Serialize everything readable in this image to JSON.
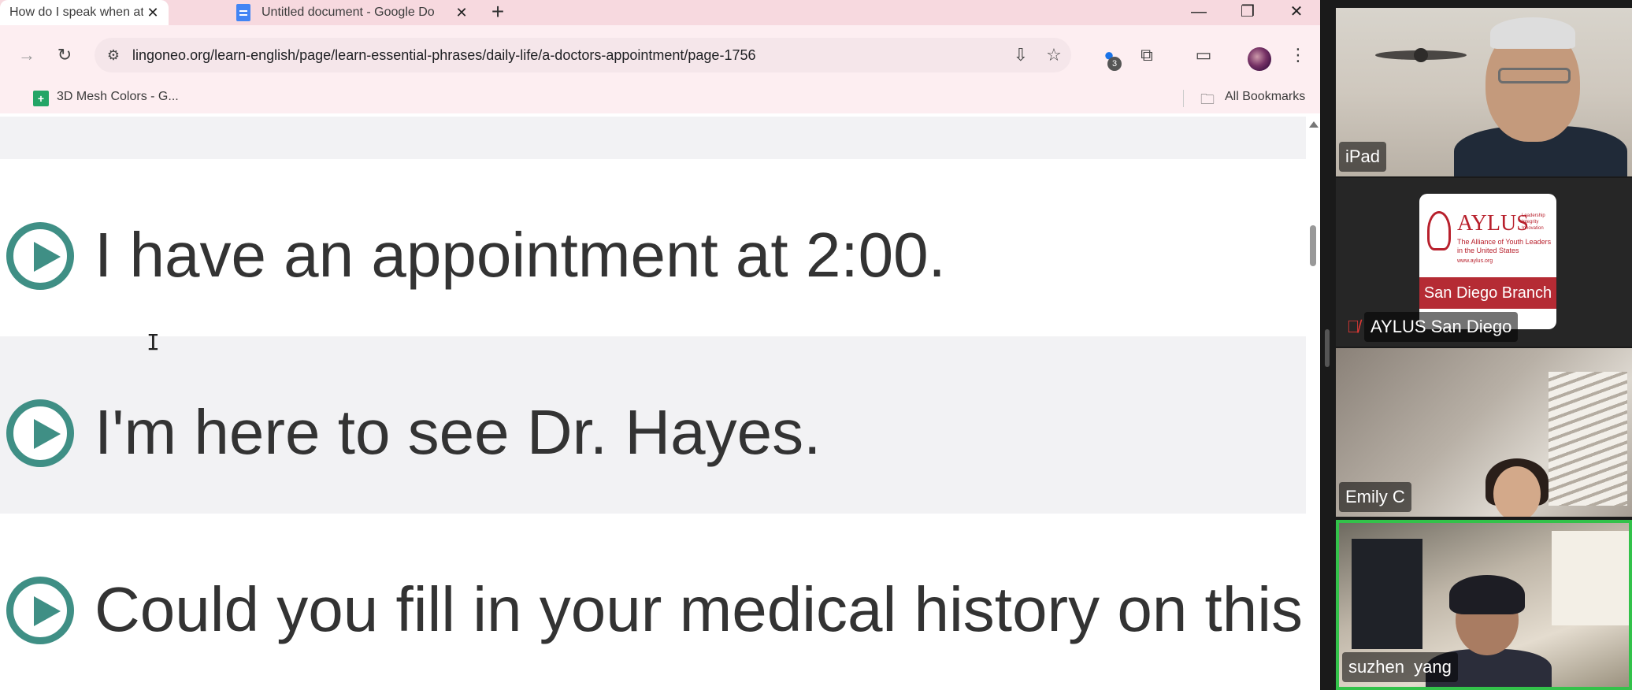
{
  "browser": {
    "tabs": [
      {
        "title": "How do I speak when at the do",
        "active": true
      },
      {
        "title": "Untitled document - Google Do",
        "active": false
      }
    ],
    "new_tab_label": "+",
    "window_controls": {
      "minimize": "—",
      "restore": "❐",
      "close": "✕"
    },
    "url": "lingoneo.org/learn-english/page/learn-essential-phrases/daily-life/a-doctors-appointment/page-1756",
    "extension_badge": "3",
    "bookmarks": {
      "item_label": "3D Mesh Colors - G...",
      "all_bookmarks": "All Bookmarks"
    }
  },
  "page": {
    "phrases": [
      "I have an appointment at 2:00.",
      "I'm here to see Dr. Hayes.",
      "Could you fill in your medical history on this form?"
    ],
    "accent_color": "#3f8f85"
  },
  "meeting": {
    "participants": [
      {
        "name": "iPad"
      },
      {
        "name": "AYLUS San Diego",
        "muted": true
      },
      {
        "name": "Emily C"
      },
      {
        "name": "suzhen  yang",
        "active_speaker": true
      }
    ],
    "aylus_logo": {
      "title": "AYLUS",
      "tagline": "Leadership Integrity Innovation",
      "subtitle": "The Alliance of Youth Leaders in the United States",
      "url": "www.aylus.org",
      "branch": "San Diego Branch"
    },
    "active_speaker_color": "#33c24a"
  }
}
